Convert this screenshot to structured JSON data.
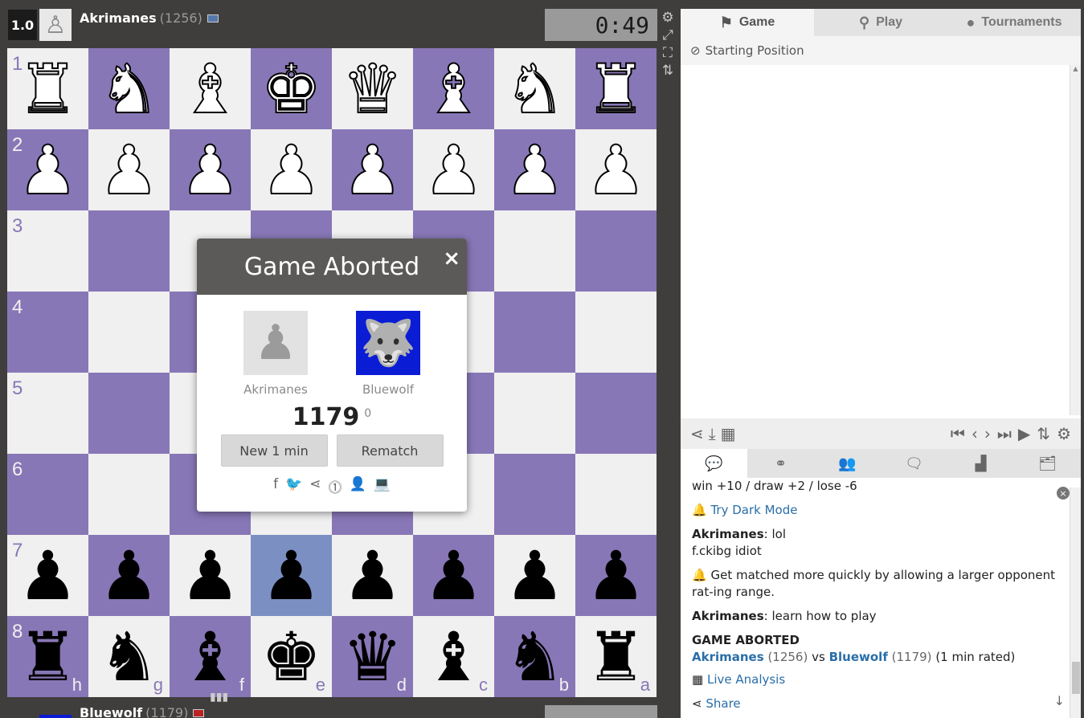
{
  "top_player": {
    "score": "1.0",
    "name": "Akrimanes",
    "rating": "(1256)",
    "clock": "0:49"
  },
  "bottom_player": {
    "name": "Bluewolf",
    "rating": "(1179)"
  },
  "board": {
    "rank_labels": [
      "1",
      "2",
      "3",
      "4",
      "5",
      "6",
      "7",
      "8"
    ],
    "file_labels": [
      "h",
      "g",
      "f",
      "e",
      "d",
      "c",
      "b",
      "a"
    ],
    "rows": [
      [
        "♜",
        "♞",
        "♝",
        "♚",
        "♛",
        "♝",
        "♞",
        "♜"
      ],
      [
        "♟",
        "♟",
        "♟",
        "♟",
        "♟",
        "♟",
        "♟",
        "♟"
      ],
      [
        "",
        "",
        "",
        "",
        "",
        "",
        "",
        ""
      ],
      [
        "",
        "",
        "",
        "",
        "",
        "",
        "",
        ""
      ],
      [
        "",
        "",
        "",
        "",
        "",
        "",
        "",
        ""
      ],
      [
        "",
        "",
        "",
        "",
        "",
        "",
        "",
        ""
      ],
      [
        "♟",
        "♟",
        "♟",
        "♟",
        "♟",
        "♟",
        "♟",
        "♟"
      ],
      [
        "♜",
        "♞",
        "♝",
        "♚",
        "♛",
        "♝",
        "♞",
        "♜"
      ]
    ],
    "highlighted_square": "e7"
  },
  "modal": {
    "title": "Game Aborted",
    "close": "×",
    "player1": "Akrimanes",
    "player2": "Bluewolf",
    "rating": "1179",
    "rating_delta": "0",
    "btn_new": "New 1 min",
    "btn_rematch": "Rematch"
  },
  "panel": {
    "tabs": [
      "Game",
      "Play",
      "Tournaments"
    ],
    "starting_position": "Starting Position"
  },
  "chat": {
    "line1": "win +10 / draw +2 / lose -6",
    "tip1": "Try Dark Mode",
    "msg1_name": "Akrimanes",
    "msg1_text": ": lol",
    "msg1_text2": "f.ckibg idiot",
    "tip2": "Get matched more quickly by allowing a larger opponent rat-ing range.",
    "msg2_name": "Akrimanes",
    "msg2_text": ": learn how to play",
    "aborted": "GAME ABORTED",
    "result_p1": "Akrimanes",
    "result_p1_rating": "(1256)",
    "result_vs": "vs",
    "result_p2": "Bluewolf",
    "result_p2_rating": "(1179)",
    "result_type": "(1 min rated)",
    "live_analysis": "Live Analysis",
    "share": "Share"
  }
}
